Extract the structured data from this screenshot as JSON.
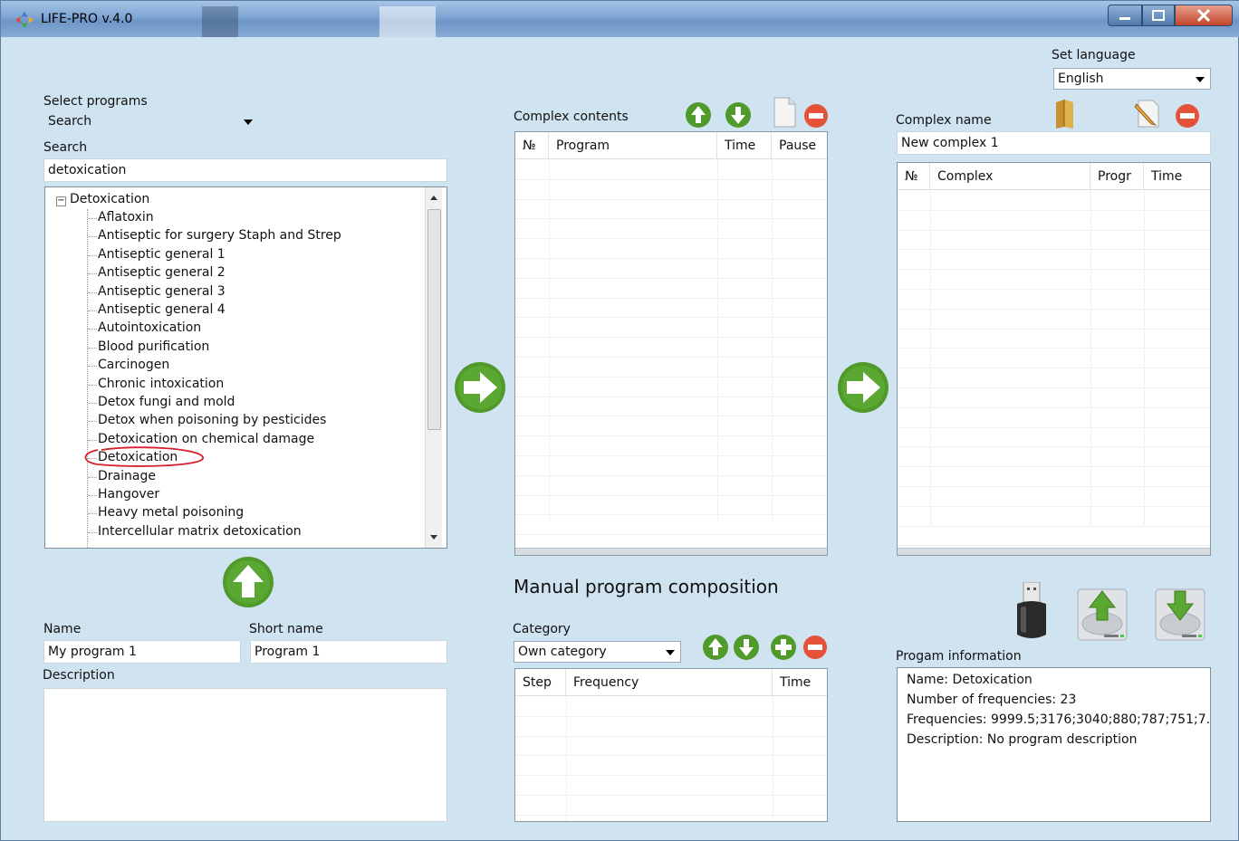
{
  "window": {
    "title": "LIFE-PRO v.4.0"
  },
  "language": {
    "label": "Set language",
    "value": "English"
  },
  "select_programs": {
    "label": "Select programs",
    "value": "Search"
  },
  "search": {
    "label": "Search",
    "value": "detoxication"
  },
  "tree": {
    "root": "Detoxication",
    "items": [
      "Aflatoxin",
      "Antiseptic for surgery Staph and Strep",
      "Antiseptic general 1",
      "Antiseptic general 2",
      "Antiseptic general 3",
      "Antiseptic general 4",
      "Autointoxication",
      "Blood purification",
      "Carcinogen",
      "Chronic intoxication",
      "Detox fungi and mold",
      "Detox when poisoning by pesticides",
      "Detoxication on chemical damage",
      "Detoxication",
      "Drainage",
      "Hangover",
      "Heavy metal poisoning",
      "Intercellular matrix detoxication"
    ],
    "selected_index": 13
  },
  "complex_contents": {
    "label": "Complex contents",
    "columns": [
      "№",
      "Program",
      "Time",
      "Pause"
    ]
  },
  "complex": {
    "name_label": "Complex name",
    "name_value": "New complex 1",
    "columns": [
      "№",
      "Complex",
      "Progr",
      "Time"
    ]
  },
  "program": {
    "name_label": "Name",
    "name_value": "My program 1",
    "short_label": "Short name",
    "short_value": "Program 1",
    "description_label": "Description",
    "description_value": ""
  },
  "manual": {
    "title": "Manual program composition",
    "category_label": "Category",
    "category_value": "Own category",
    "columns": [
      "Step",
      "Frequency",
      "Time"
    ]
  },
  "program_info": {
    "label": "Progam information",
    "name": "Name: Detoxication",
    "count": "Number of frequencies: 23",
    "frequencies": "Frequencies: 9999.5;3176;3040;880;787;751;7...",
    "description": "Description: No program description"
  },
  "colors": {
    "background": "#cfe3f1",
    "green_button": "#4f9a2a",
    "red_button": "#e4523a"
  }
}
